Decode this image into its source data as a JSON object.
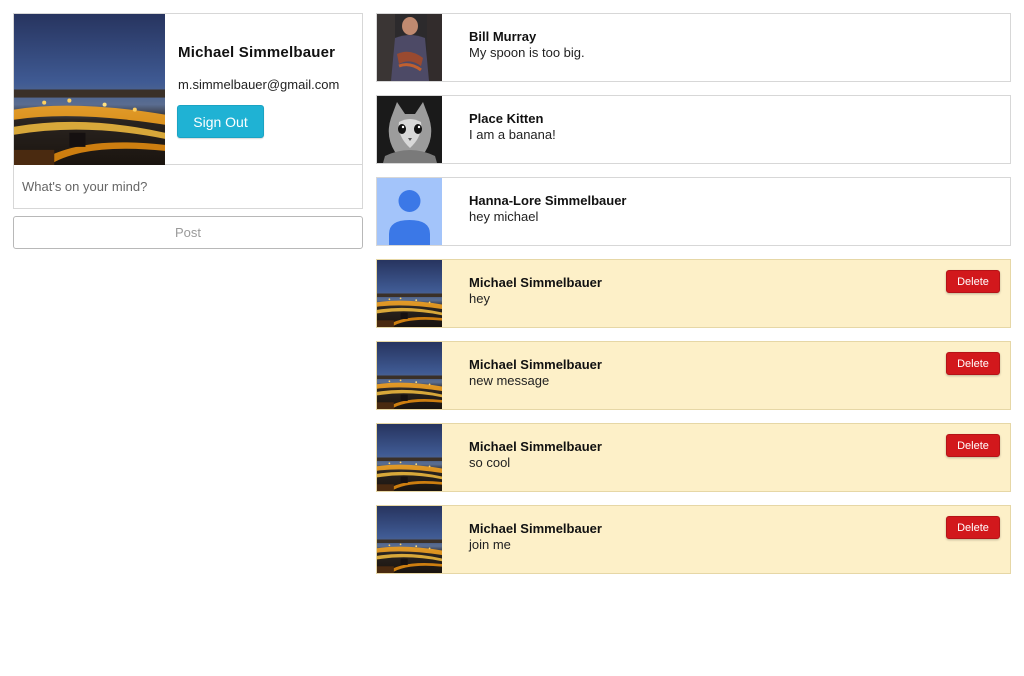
{
  "profile": {
    "name": "Michael Simmelbauer",
    "email": "m.simmelbauer@gmail.com",
    "sign_out_label": "Sign Out",
    "photo": "city-night-photo"
  },
  "composer": {
    "placeholder": "What's on your mind?",
    "value": "",
    "post_label": "Post"
  },
  "feed": {
    "posts": [
      {
        "author": "Bill Murray",
        "text": "My spoon is too big.",
        "avatar": "bill-murray-photo",
        "own": false
      },
      {
        "author": "Place Kitten",
        "text": "I am a banana!",
        "avatar": "kitten-photo",
        "own": false
      },
      {
        "author": "Hanna-Lore Simmelbauer",
        "text": "hey michael",
        "avatar": "default-user-avatar",
        "own": false
      },
      {
        "author": "Michael Simmelbauer",
        "text": "hey",
        "avatar": "city-night-photo",
        "own": true,
        "delete_label": "Delete"
      },
      {
        "author": "Michael Simmelbauer",
        "text": "new message",
        "avatar": "city-night-photo",
        "own": true,
        "delete_label": "Delete"
      },
      {
        "author": "Michael Simmelbauer",
        "text": "so cool",
        "avatar": "city-night-photo",
        "own": true,
        "delete_label": "Delete"
      },
      {
        "author": "Michael Simmelbauer",
        "text": "join me",
        "avatar": "city-night-photo",
        "own": true,
        "delete_label": "Delete"
      }
    ]
  },
  "colors": {
    "sign_out_button": "#1fb2d4",
    "delete_button": "#d2181c",
    "own_post_background": "#fdf0c8",
    "default_avatar_bg": "#a3c4fa",
    "default_avatar_fg": "#3b78e7"
  }
}
